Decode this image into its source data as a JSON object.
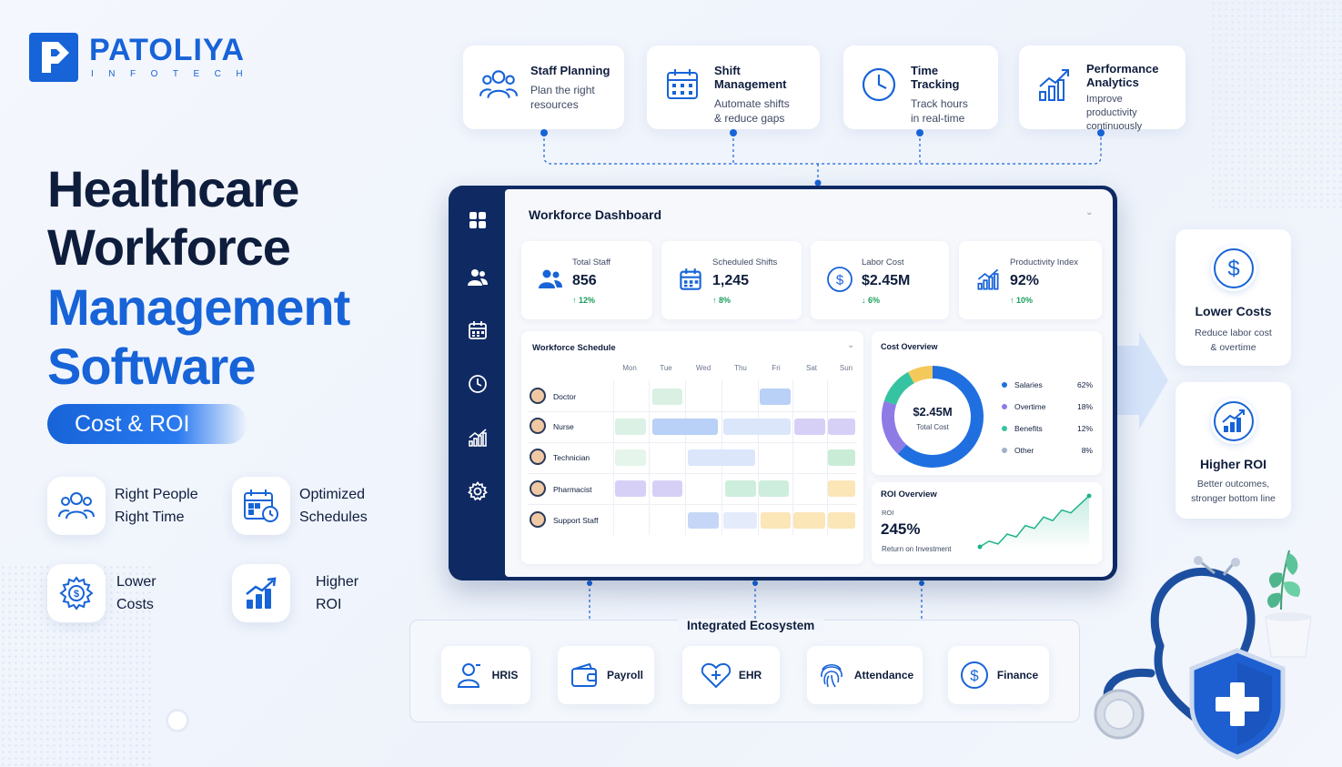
{
  "brand": {
    "name": "PATOLIYA",
    "sub": "INFOTECH",
    "color": "#1763d8"
  },
  "hero": {
    "line1": "Healthcare",
    "line2": "Workforce",
    "line3": "Management",
    "line4": "Software",
    "pill": "Cost & ROI"
  },
  "features": [
    {
      "icon": "people-icon",
      "text": "Right People\nRight Time"
    },
    {
      "icon": "calendar-clock-icon",
      "text": "Optimized\nSchedules"
    },
    {
      "icon": "gear-dollar-icon",
      "text": "Lower\nCosts"
    },
    {
      "icon": "chart-up-icon",
      "text": "Higher\nROI"
    }
  ],
  "top_cards": [
    {
      "title": "Staff Planning",
      "desc": "Plan the right\nresources",
      "icon": "people-icon"
    },
    {
      "title": "Shift Management",
      "desc": "Automate shifts\n& reduce gaps",
      "icon": "calendar-icon"
    },
    {
      "title": "Time Tracking",
      "desc": "Track hours\nin real-time",
      "icon": "clock-icon"
    },
    {
      "title": "Performance\nAnalytics",
      "desc": "Improve productivity\ncontinuously",
      "icon": "chart-up-icon"
    }
  ],
  "dashboard": {
    "title": "Workforce Dashboard",
    "kpis": [
      {
        "label": "Total Staff",
        "value": "856",
        "change": "↑ 12%",
        "direction": "up",
        "icon": "people-icon"
      },
      {
        "label": "Scheduled Shifts",
        "value": "1,245",
        "change": "↑ 8%",
        "direction": "up",
        "icon": "calendar-icon"
      },
      {
        "label": "Labor Cost",
        "value": "$2.45M",
        "change": "↓ 6%",
        "direction": "down",
        "icon": "dollar-icon"
      },
      {
        "label": "Productivity Index",
        "value": "92%",
        "change": "↑ 10%",
        "direction": "up",
        "icon": "chart-up-icon"
      }
    ],
    "schedule": {
      "title": "Workforce Schedule",
      "days": [
        "Mon",
        "Tue",
        "Wed",
        "Thu",
        "Fri",
        "Sat",
        "Sun"
      ],
      "roles": [
        "Doctor",
        "Nurse",
        "Technician",
        "Pharmacist",
        "Support Staff"
      ]
    },
    "cost_overview": {
      "title": "Cost Overview",
      "total": "$2.45M",
      "total_label": "Total Cost"
    },
    "roi": {
      "title": "ROI Overview",
      "label": "ROI",
      "value": "245%",
      "sub": "Return on Investment"
    }
  },
  "chart_data": [
    {
      "type": "pie",
      "title": "Cost Overview",
      "categories": [
        "Salaries",
        "Overtime",
        "Benefits",
        "Other"
      ],
      "values": [
        62,
        18,
        12,
        8
      ],
      "labels": [
        "62%",
        "18%",
        "12%",
        "8%"
      ],
      "colors": [
        "#1f6fe0",
        "#8e7be6",
        "#36c3a1",
        "#f3c95a"
      ]
    },
    {
      "type": "line",
      "title": "ROI Overview",
      "x": [
        0,
        1,
        2,
        3,
        4,
        5,
        6,
        7,
        8,
        9,
        10,
        11,
        12
      ],
      "values": [
        10,
        18,
        14,
        28,
        24,
        40,
        36,
        52,
        47,
        62,
        58,
        70,
        82
      ],
      "color": "#1fb38a"
    }
  ],
  "side_cards": [
    {
      "title": "Lower Costs",
      "desc": "Reduce labor cost\n& overtime",
      "icon": "dollar-icon"
    },
    {
      "title": "Higher ROI",
      "desc": "Better outcomes,\nstronger bottom line",
      "icon": "chart-up-icon"
    }
  ],
  "ecosystem": {
    "title": "Integrated Ecosystem",
    "items": [
      {
        "label": "HRIS",
        "icon": "person-icon"
      },
      {
        "label": "Payroll",
        "icon": "wallet-icon"
      },
      {
        "label": "EHR",
        "icon": "heart-plus-icon"
      },
      {
        "label": "Attendance",
        "icon": "fingerprint-icon"
      },
      {
        "label": "Finance",
        "icon": "dollar-icon"
      }
    ]
  },
  "colors": {
    "primary": "#1763d8",
    "navy": "#0f1d3d",
    "sidebar": "#0f2a63",
    "positive": "#1a9e5c"
  }
}
